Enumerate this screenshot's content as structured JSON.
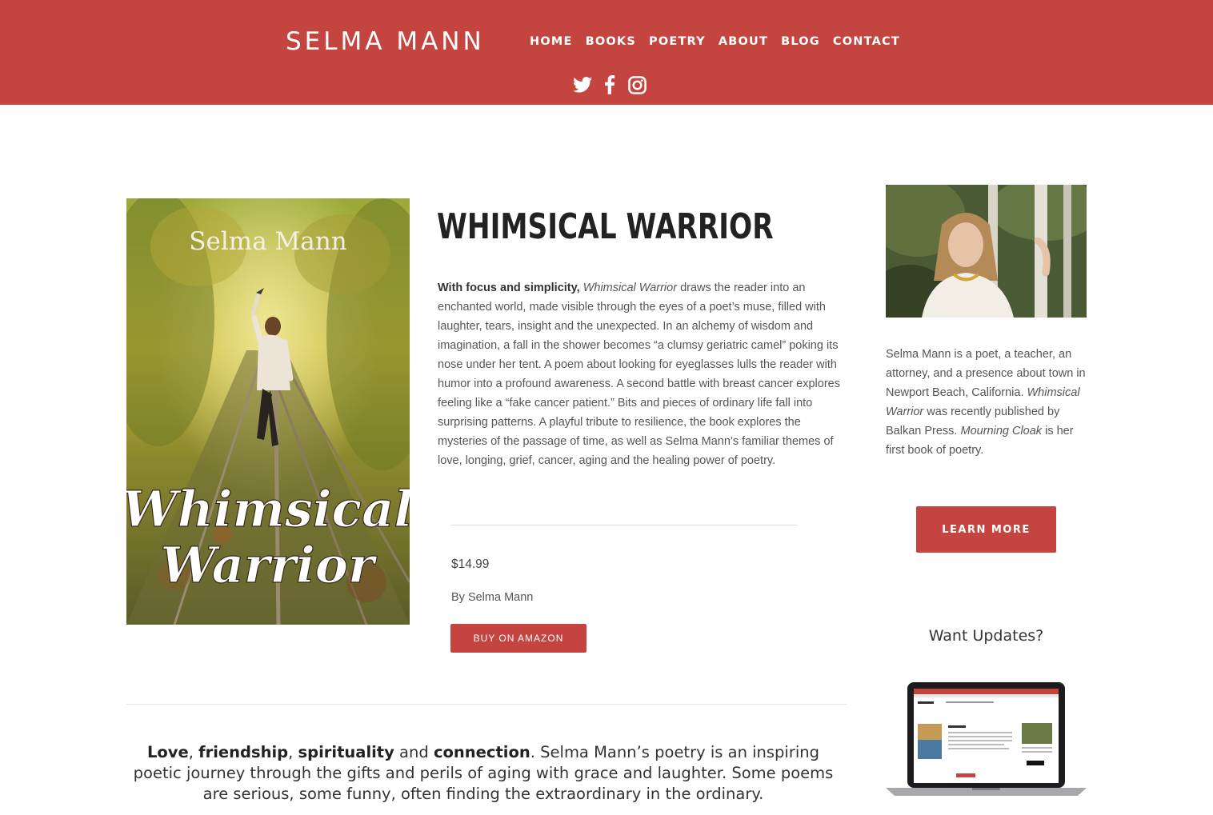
{
  "header": {
    "logo": "SELMA MANN",
    "nav": [
      "HOME",
      "BOOKS",
      "POETRY",
      "ABOUT",
      "BLOG",
      "CONTACT"
    ],
    "social_icons": [
      "twitter-icon",
      "facebook-icon",
      "instagram-icon"
    ]
  },
  "book": {
    "cover_author": "Selma Mann",
    "cover_title_line1": "Whimsical",
    "cover_title_line2": "Warrior",
    "title": "WHIMSICAL WARRIOR",
    "description_lead": "With focus and simplicity,",
    "description_italic": "Whimsical Warrior",
    "description_rest": " draws the reader into an enchanted world, made visible through the eyes of a poet’s muse, filled with laughter, tears, insight and the unexpected.  In an alchemy of wisdom and imagination, a fall in the shower becomes “a clumsy geriatric camel” poking its nose under her tent. A poem about looking for eyeglasses lulls the reader with humor into a profound awareness.  A second battle with breast cancer explores feeling like a “fake cancer patient.”  Bits and pieces of ordinary life fall into surprising patterns.  A playful tribute to resilience, the book explores the mysteries of the passage of time, as well as Selma Mann’s familiar themes of love, longing, grief, cancer, aging and the healing power of poetry.",
    "price": "$14.99",
    "byline": "By Selma Mann",
    "buy_label": "BUY ON AMAZON"
  },
  "tagline": {
    "w1": "Love",
    "s1": ", ",
    "w2": "friendship",
    "s2": ", ",
    "w3": "spirituality",
    "s3": " and ",
    "w4": "connection",
    "rest": ". Selma Mann’s poetry is an inspiring poetic journey through the gifts and perils of aging with grace and laughter. Some poems  are serious, some funny, often finding the extraordinary in the ordinary."
  },
  "sidebar": {
    "bio_1": "Selma Mann is a poet, a teacher, an attorney, and a presence about town in Newport Beach, California. ",
    "bio_italic_1": "Whimsical Warrior",
    "bio_2": " was recently published by Balkan Press. ",
    "bio_italic_2": "Mourning Cloak",
    "bio_3": " is her first book of poetry.",
    "learn_more": "LEARN MORE",
    "updates_heading": "Want Updates?"
  },
  "colors": {
    "brand_red": "#c44540",
    "white": "#ffffff"
  }
}
